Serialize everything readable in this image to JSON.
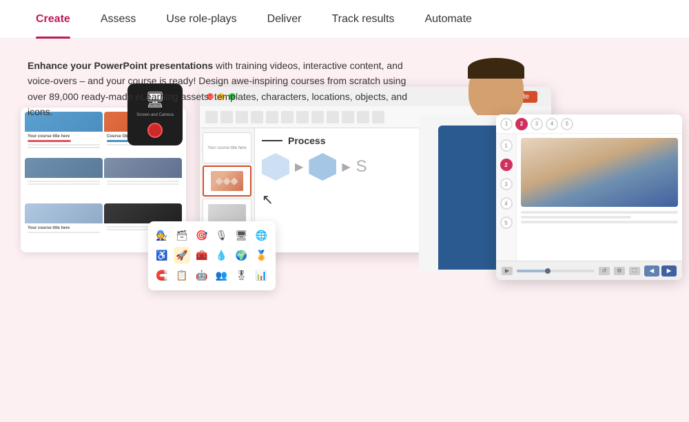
{
  "nav": {
    "items": [
      {
        "id": "create",
        "label": "Create",
        "active": true
      },
      {
        "id": "assess",
        "label": "Assess",
        "active": false
      },
      {
        "id": "role-plays",
        "label": "Use role-plays",
        "active": false
      },
      {
        "id": "deliver",
        "label": "Deliver",
        "active": false
      },
      {
        "id": "track",
        "label": "Track results",
        "active": false
      },
      {
        "id": "automate",
        "label": "Automate",
        "active": false
      }
    ]
  },
  "main": {
    "description": {
      "bold_part": "Enhance your PowerPoint presentations",
      "rest": " with training videos, interactive content, and voice-overs – and your course is ready! Design awe-inspiring courses from scratch using over 89,000 ready-made eLearning assets: templates, characters, locations, objects, and icons."
    },
    "ispring_tab_label": "iSpring Suite",
    "process_label": "Process",
    "screen_camera_label": "Screen and Camera"
  },
  "player": {
    "steps": [
      "1",
      "2",
      "3",
      "4",
      "5"
    ]
  }
}
